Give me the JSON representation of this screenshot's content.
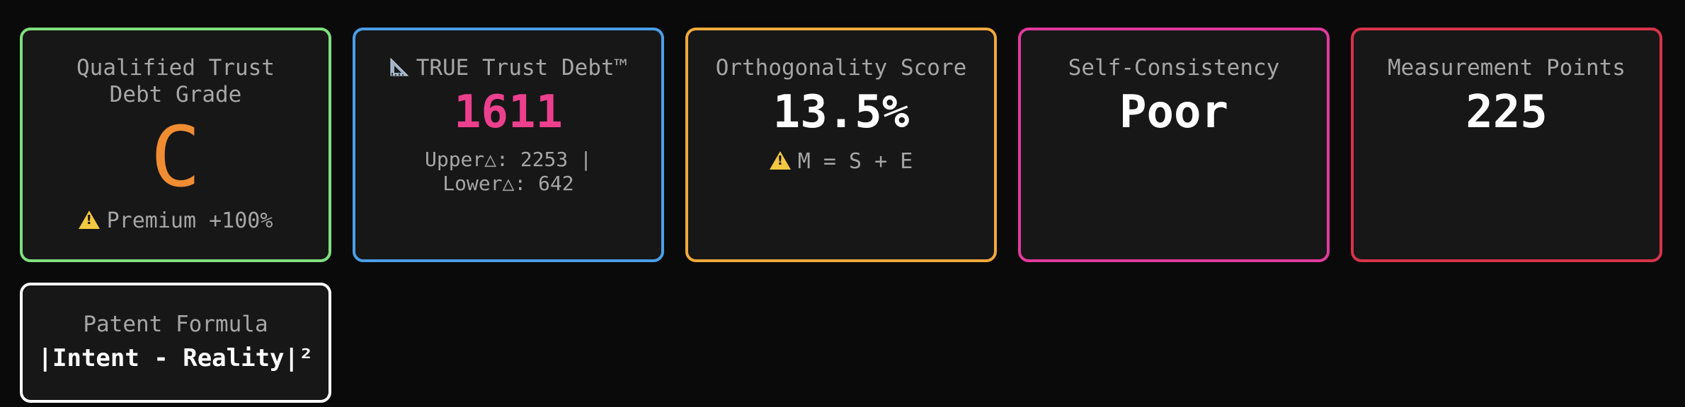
{
  "colors": {
    "background": "#0a0a0a",
    "card_background": "#171717",
    "green_border": "#7ee07e",
    "blue_border": "#4a9fe8",
    "orange_border": "#f2a93b",
    "pink_border": "#e23a9f",
    "red_border": "#d8334a",
    "white_border": "#ffffff",
    "grade_color": "#f08c32",
    "debt_color": "#ec3f8e",
    "warning_color": "#f5c842"
  },
  "cards": {
    "grade": {
      "title": "Qualified Trust Debt Grade",
      "value": "C",
      "note_icon": "warning-icon",
      "note": "Premium +100%"
    },
    "true_debt": {
      "title_icon": "triangular-ruler-icon",
      "title": "TRUE Trust Debt™",
      "value": "1611",
      "detail": "Upper△: 2253 | Lower△: 642"
    },
    "orthogonality": {
      "title": "Orthogonality Score",
      "value": "13.5%",
      "note_icon": "warning-icon",
      "note": "M = S + E"
    },
    "self_consistency": {
      "title": "Self-Consistency",
      "value": "Poor"
    },
    "measurement_points": {
      "title": "Measurement Points",
      "value": "225"
    },
    "patent_formula": {
      "title": "Patent Formula",
      "value": "|Intent - Reality|²"
    }
  }
}
